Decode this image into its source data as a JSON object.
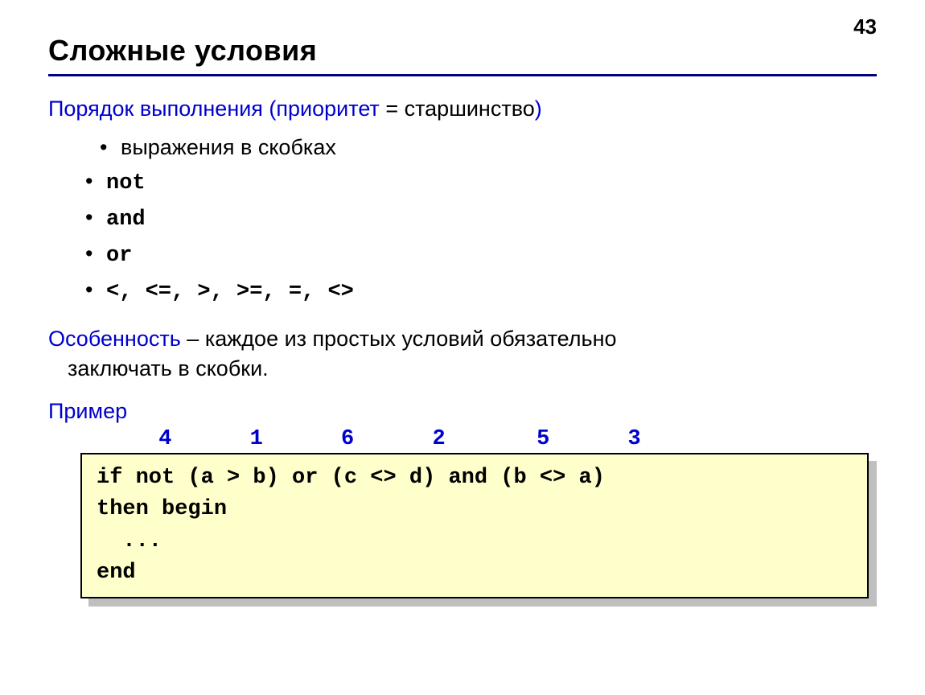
{
  "page_number": "43",
  "title": "Сложные условия",
  "section1": {
    "label_blue": "Порядок выполнения (приоритет",
    "equals": " = ",
    "label_black": "старшинство",
    "close_paren": ")"
  },
  "bullets": [
    "выражения в скобках",
    "not",
    "and",
    "or",
    "<, <=, >, >=, =, <>"
  ],
  "section2": {
    "label_blue": "Особенность",
    "dash": " – ",
    "line1_rest": "каждое из простых условий обязательно",
    "line2": "заключать в скобки."
  },
  "example_label": "Пример",
  "num_row": "      4      1      6      2       5      3",
  "code": {
    "l1": "if not (a > b) or (c <> d) and (b <> a)",
    "l2": "then begin",
    "l3": "  ...",
    "l4": "end"
  }
}
